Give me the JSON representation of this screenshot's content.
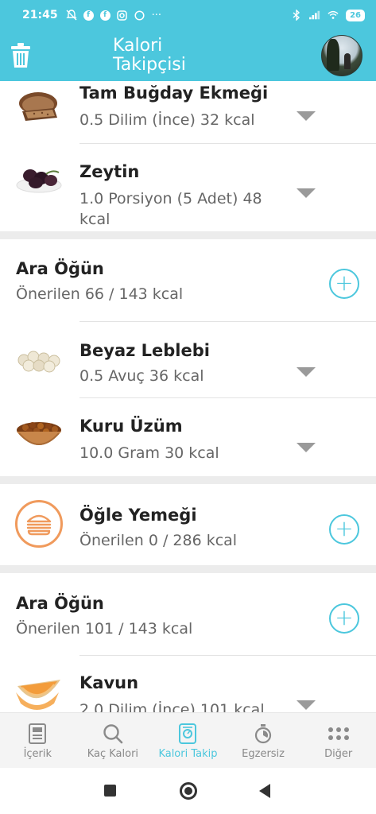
{
  "status_bar": {
    "time": "21:45",
    "battery": "26"
  },
  "app": {
    "title_line1": "Kalori",
    "title_line2": "Takipçisi"
  },
  "foods_top": [
    {
      "name": "Tam Buğday Ekmeği",
      "amount": "0.5 Dilim (İnce) 32 kcal",
      "icon": "bread-image"
    },
    {
      "name": "Zeytin",
      "amount": "1.0 Porsiyon (5 Adet) 48 kcal",
      "icon": "olive-image"
    }
  ],
  "meals": [
    {
      "title": "Ara Öğün",
      "recommended": "Önerilen 66 / 143 kcal",
      "foods": [
        {
          "name": "Beyaz Leblebi",
          "amount": "0.5 Avuç 36 kcal",
          "icon": "chickpea-image"
        },
        {
          "name": "Kuru Üzüm",
          "amount": "10.0 Gram 30 kcal",
          "icon": "raisin-image"
        }
      ]
    },
    {
      "title": "Öğle Yemeği",
      "recommended": "Önerilen 0 / 286 kcal",
      "icon": "burger-icon",
      "foods": []
    },
    {
      "title": "Ara Öğün",
      "recommended": "Önerilen 101 / 143 kcal",
      "foods": [
        {
          "name": "Kavun",
          "amount": "2.0 Dilim (İnce) 101 kcal",
          "icon": "melon-image"
        }
      ]
    }
  ],
  "bottom_nav": [
    {
      "label": "İçerik",
      "icon": "document-icon",
      "active": false
    },
    {
      "label": "Kaç Kalori",
      "icon": "search-icon",
      "active": false
    },
    {
      "label": "Kalori Takip",
      "icon": "scale-icon",
      "active": true
    },
    {
      "label": "Egzersiz",
      "icon": "stopwatch-icon",
      "active": false
    },
    {
      "label": "Diğer",
      "icon": "more-dots-icon",
      "active": false
    }
  ],
  "colors": {
    "accent": "#4cc7dd",
    "meal_icon": "#f09a5c",
    "muted_text": "#666666"
  }
}
